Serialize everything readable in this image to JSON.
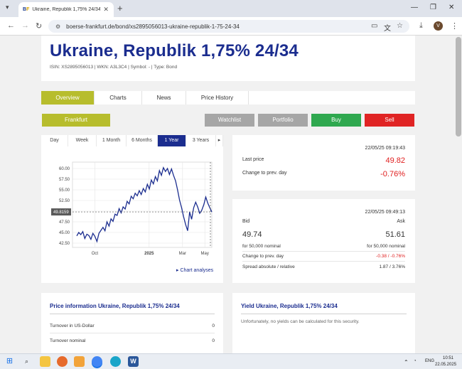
{
  "browser": {
    "tab_title": "Ukraine, Republik 1,75% 24/34 Bo",
    "favicon_b": "B",
    "favicon_f": "F",
    "url": "boerse-frankfurt.de/bond/xs2895056013-ukraine-republik-1-75-24-34",
    "avatar_letter": "V"
  },
  "header": {
    "title": "Ukraine, Republik 1,75% 24/34",
    "meta": "ISIN: XS2895056013 | WKN: A3L3C4 | Symbol: - | Type: Bond"
  },
  "nav_tabs": [
    "Overview",
    "Charts",
    "News",
    "Price History"
  ],
  "actions": {
    "exchange": "Frankfurt",
    "watchlist": "Watchlist",
    "portfolio": "Portfolio",
    "buy": "Buy",
    "sell": "Sell"
  },
  "colors": {
    "accent_olive": "#b7bd2d",
    "brand_blue": "#1b2d8f",
    "buy_green": "#2fa84f",
    "sell_red": "#e02424",
    "grey_button": "#a6a6a6"
  },
  "chart_ranges": [
    "Day",
    "Week",
    "1 Month",
    "6 Months",
    "1 Year",
    "3 Years"
  ],
  "chart_link": "Chart analyses",
  "chart_data": {
    "type": "line",
    "ylim": [
      41.5,
      61.5
    ],
    "yticks": [
      "60.00",
      "57.50",
      "55.00",
      "52.50",
      "50.00",
      "47.50",
      "45.00",
      "42.50"
    ],
    "ytick_values": [
      60,
      57.5,
      55,
      52.5,
      50,
      47.5,
      45,
      42.5
    ],
    "xticks": [
      "Oct",
      "2025",
      "Mar",
      "May"
    ],
    "xtick_positions": [
      0.16,
      0.55,
      0.79,
      0.95
    ],
    "current_value_label": "49.8159",
    "current_value": 49.82,
    "grid": true,
    "values": [
      44.2,
      45.0,
      44.5,
      45.2,
      43.6,
      44.6,
      44.3,
      43.4,
      44.8,
      44.1,
      42.9,
      44.8,
      45.5,
      46.2,
      45.4,
      47.5,
      46.5,
      48.2,
      47.6,
      49.3,
      49.0,
      50.6,
      49.6,
      51.0,
      50.5,
      52.3,
      51.7,
      53.5,
      52.9,
      54.2,
      53.6,
      54.8,
      53.9,
      55.3,
      54.5,
      56.3,
      55.2,
      57.3,
      56.4,
      58.1,
      57.1,
      59.5,
      58.4,
      60.2,
      59.3,
      60.0,
      58.6,
      59.9,
      58.4,
      57.1,
      55.0,
      52.6,
      50.8,
      48.7,
      46.9,
      45.4,
      49.8,
      48.1,
      50.8,
      52.1,
      51.0,
      49.5,
      50.2,
      51.5,
      53.3,
      51.9,
      50.8,
      49.8
    ]
  },
  "last_price": {
    "timestamp": "22/05/25 09:19:43",
    "label": "Last price",
    "value": "49.82",
    "change_label": "Change to prev. day",
    "change": "-0.76%"
  },
  "bid_ask": {
    "timestamp": "22/05/25 09:49:13",
    "bid_label": "Bid",
    "ask_label": "Ask",
    "bid": "49.74",
    "ask": "51.61",
    "bid_nominal": "for 50,000 nominal",
    "ask_nominal": "for 50,000 nominal",
    "change_label": "Change to prev. day",
    "change": "-0.38 / -0.76%",
    "spread_label": "Spread absolute / relative",
    "spread": "1.87 / 3.76%"
  },
  "price_info": {
    "title": "Price information Ukraine, Republik 1,75% 24/34",
    "rows": [
      {
        "label": "Turnover in US-Dollar",
        "value": "0"
      },
      {
        "label": "Turnover nominal",
        "value": "0"
      }
    ]
  },
  "yield": {
    "title": "Yield Ukraine, Republik 1,75% 24/34",
    "text": "Unfortunately, no yields can be calculated for this security."
  },
  "taskbar": {
    "lang": "ENG",
    "time": "10:51",
    "date": "22.05.2025"
  }
}
